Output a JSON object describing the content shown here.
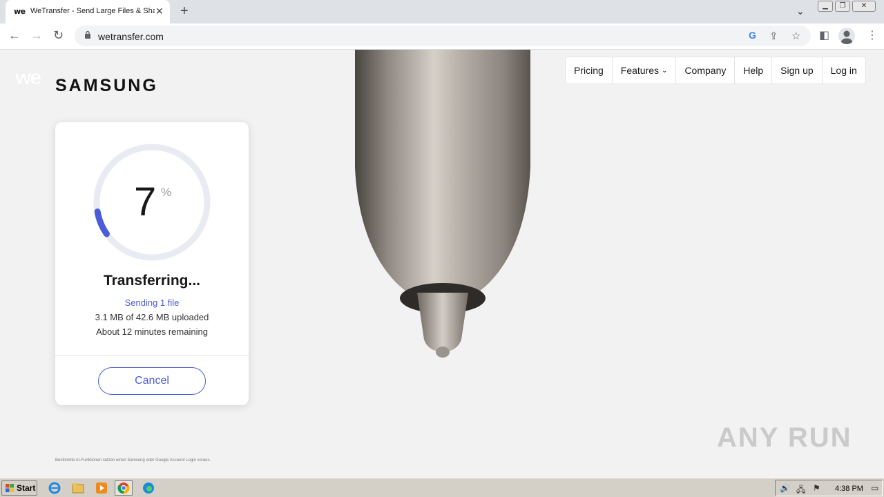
{
  "browser": {
    "tab_title": "WeTransfer - Send Large Files & Sha",
    "favicon_text": "we",
    "url": "wetransfer.com"
  },
  "page": {
    "brand": "SAMSUNG",
    "nav": [
      "Pricing",
      "Features",
      "Company",
      "Help",
      "Sign up",
      "Log in"
    ],
    "transfer": {
      "percent": "7",
      "percent_sign": "%",
      "progress_fraction": 0.07,
      "status": "Transferring...",
      "sending": "Sending 1 file",
      "uploaded": "3.1 MB of 42.6 MB uploaded",
      "remaining": "About 12 minutes remaining",
      "cancel_label": "Cancel"
    },
    "fine_print": "Bestimmte AI-Funktionen setzen einen Samsung oder Google Account Login voraus.",
    "watermark": "ANY RUN"
  },
  "taskbar": {
    "start_label": "Start",
    "clock": "4:38 PM"
  },
  "colors": {
    "accent": "#4a5cd8",
    "ring_track": "#e8ebf1",
    "ring_fill": "#4a5cd8"
  }
}
